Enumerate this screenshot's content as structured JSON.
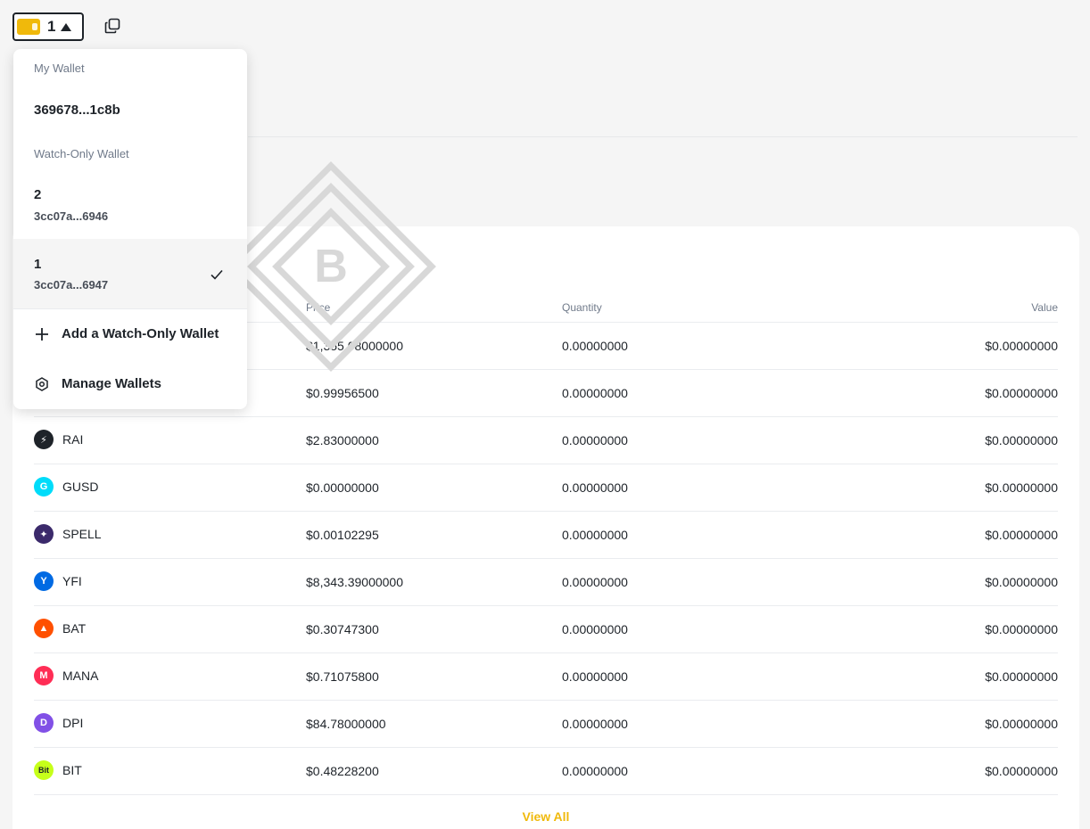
{
  "header": {
    "wallet_name": "1",
    "copy_icon": "copy-icon",
    "wallet_icon": "wallet-icon",
    "caret_icon": "caret-up-icon"
  },
  "dropdown": {
    "my_wallet_label": "My Wallet",
    "my_wallet_address": "369678...1c8b",
    "watch_only_label": "Watch-Only Wallet",
    "watch_wallets": [
      {
        "name": "2",
        "address": "3cc07a...6946",
        "selected": false
      },
      {
        "name": "1",
        "address": "3cc07a...6947",
        "selected": true
      }
    ],
    "add_label": "Add a Watch-Only Wallet",
    "manage_label": "Manage Wallets"
  },
  "table": {
    "headers": {
      "price": "Price",
      "quantity": "Quantity",
      "value": "Value"
    },
    "rows": [
      {
        "asset": "",
        "price": "$1,355.08000000",
        "quantity": "0.00000000",
        "value": "$0.00000000"
      },
      {
        "asset": "",
        "price": "$0.99956500",
        "quantity": "0.00000000",
        "value": "$0.00000000"
      },
      {
        "asset": "RAI",
        "price": "$2.83000000",
        "quantity": "0.00000000",
        "value": "$0.00000000",
        "color": "#1e2329",
        "glyph": "⚡"
      },
      {
        "asset": "GUSD",
        "price": "$0.00000000",
        "quantity": "0.00000000",
        "value": "$0.00000000",
        "color": "#00dcfa",
        "glyph": "G"
      },
      {
        "asset": "SPELL",
        "price": "$0.00102295",
        "quantity": "0.00000000",
        "value": "$0.00000000",
        "color": "#3b2a6b",
        "glyph": "✦"
      },
      {
        "asset": "YFI",
        "price": "$8,343.39000000",
        "quantity": "0.00000000",
        "value": "$0.00000000",
        "color": "#006ae3",
        "glyph": "Y"
      },
      {
        "asset": "BAT",
        "price": "$0.30747300",
        "quantity": "0.00000000",
        "value": "$0.00000000",
        "color": "#ff5000",
        "glyph": "▲"
      },
      {
        "asset": "MANA",
        "price": "$0.71075800",
        "quantity": "0.00000000",
        "value": "$0.00000000",
        "color": "#ff2d55",
        "glyph": "M"
      },
      {
        "asset": "DPI",
        "price": "$84.78000000",
        "quantity": "0.00000000",
        "value": "$0.00000000",
        "color": "#8150e6",
        "glyph": "D"
      },
      {
        "asset": "BIT",
        "price": "$0.48228200",
        "quantity": "0.00000000",
        "value": "$0.00000000",
        "color": "#c6ff1a",
        "glyph": "Bit"
      }
    ],
    "view_all": "View All"
  },
  "colors": {
    "accent": "#f0b90b",
    "text": "#1e2329",
    "muted": "#707a8a"
  }
}
